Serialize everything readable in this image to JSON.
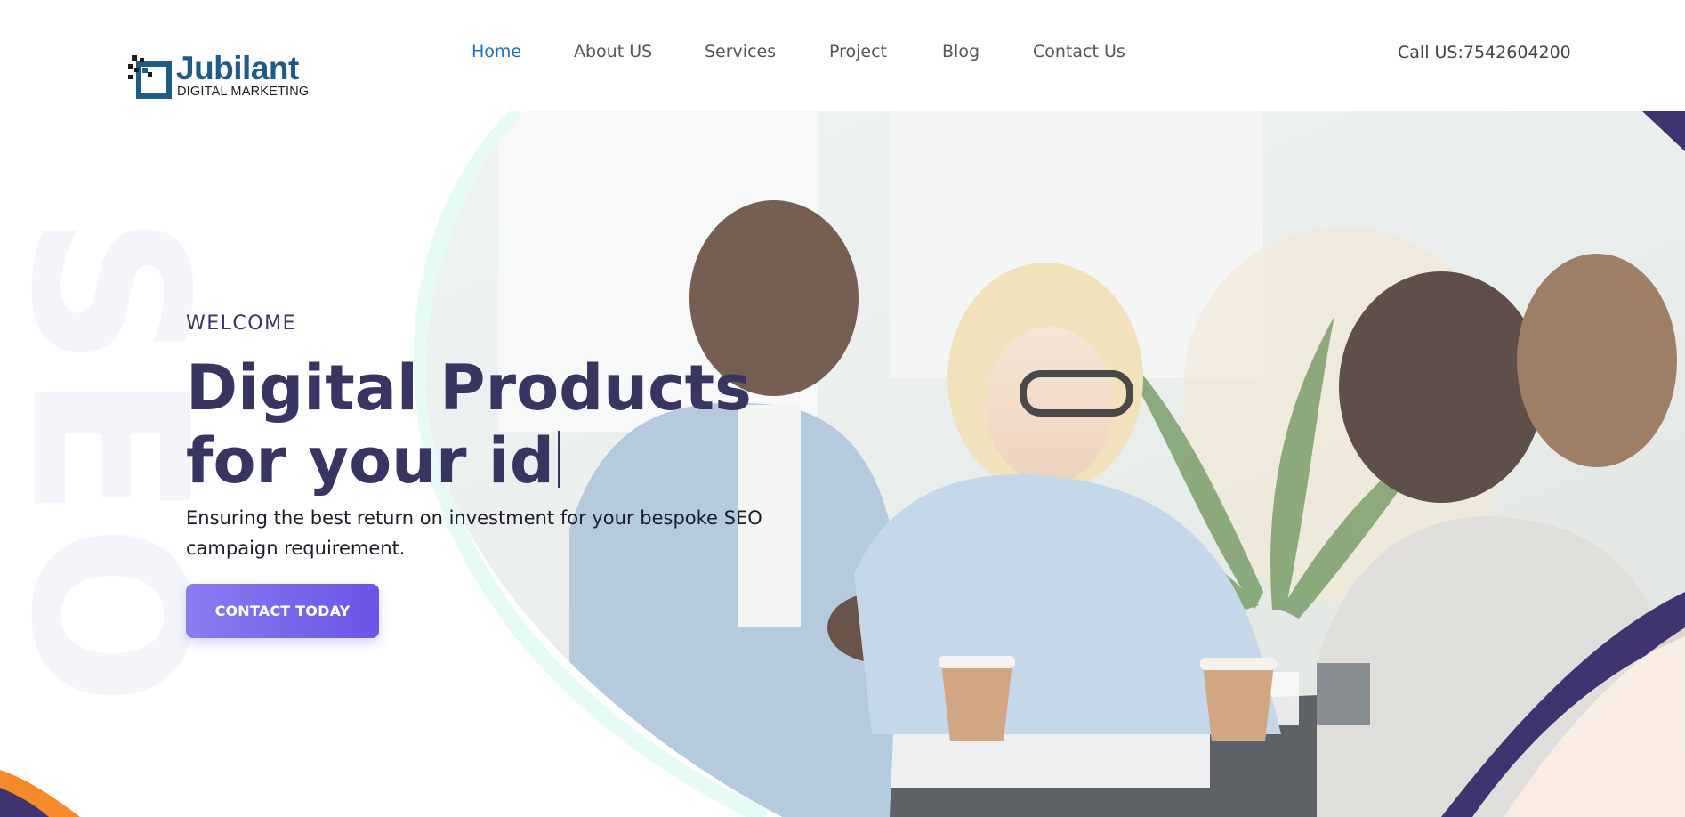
{
  "brand": {
    "name": "Jubilant",
    "tagline": "DIGITAL MARKETING",
    "color": "#1f5b87"
  },
  "nav": {
    "items": [
      {
        "label": "Home",
        "active": true
      },
      {
        "label": "About US",
        "active": false
      },
      {
        "label": "Services",
        "active": false
      },
      {
        "label": "Project",
        "active": false
      },
      {
        "label": "Blog",
        "active": false
      },
      {
        "label": "Contact Us",
        "active": false
      }
    ],
    "active_color": "#1e6fc4"
  },
  "call": "Call US:7542604200",
  "hero": {
    "welcome": "WELCOME",
    "headline_line1": "Digital Products",
    "headline_line2": "for your id",
    "subtext": "Ensuring the best return on investment for your bespoke SEO campaign requirement.",
    "cta_label": "CONTACT TODAY",
    "watermark": "SEO",
    "photo_description_icon": "team-meeting-photo"
  },
  "colors": {
    "heading": "#383563",
    "cta_start": "#8a7cf0",
    "cta_end": "#6a55e6",
    "accent_purple": "#3f3470",
    "accent_orange": "#f58a2a"
  }
}
